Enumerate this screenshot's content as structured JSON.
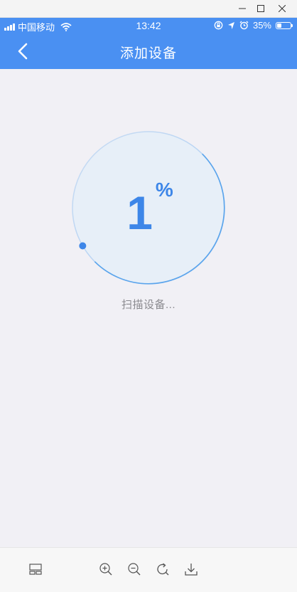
{
  "status_bar": {
    "carrier": "中国移动",
    "time": "13:42",
    "battery_percent": "35%",
    "battery_level": 0.35
  },
  "navbar": {
    "title": "添加设备",
    "back_icon": "chevron-left-icon"
  },
  "progress": {
    "value": "1",
    "unit": "%",
    "fraction": 0.01,
    "status_text": "扫描设备..."
  },
  "toolbar": {
    "icons": [
      "layout-icon",
      "zoom-in-icon",
      "zoom-out-icon",
      "rotate-icon",
      "download-icon"
    ]
  },
  "colors": {
    "accent": "#4a90f2",
    "progress_text": "#3d86e8",
    "background": "#f1f0f5"
  }
}
